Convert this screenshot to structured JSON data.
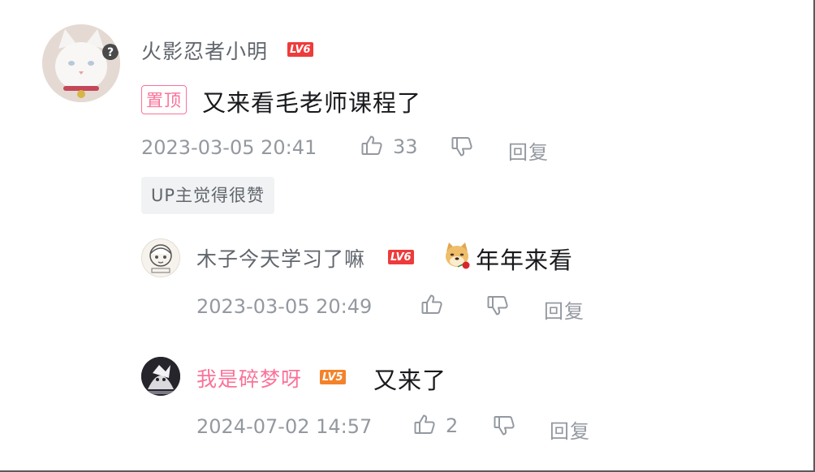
{
  "comment": {
    "username": "火影忍者小明",
    "level": "LV6",
    "pin_label": "置顶",
    "text": "又来看毛老师课程了",
    "timestamp": "2023-03-05 20:41",
    "like_count": "33",
    "reply_label": "回复",
    "up_tag": "UP主觉得很赞"
  },
  "replies": [
    {
      "username": "木子今天学习了嘛",
      "level": "LV6",
      "text": "年年来看",
      "timestamp": "2023-03-05 20:49",
      "like_count": "",
      "reply_label": "回复"
    },
    {
      "username": "我是碎梦呀",
      "level": "LV5",
      "text": "又来了",
      "timestamp": "2024-07-02 14:57",
      "like_count": "2",
      "reply_label": "回复"
    }
  ],
  "colors": {
    "pink": "#fb7299",
    "meta_gray": "#9499a0",
    "name_gray": "#61666d",
    "lv6": "#ee3b3b",
    "lv5": "#f4822a"
  },
  "icons": [
    "like-icon",
    "dislike-icon",
    "doge-emoji"
  ]
}
